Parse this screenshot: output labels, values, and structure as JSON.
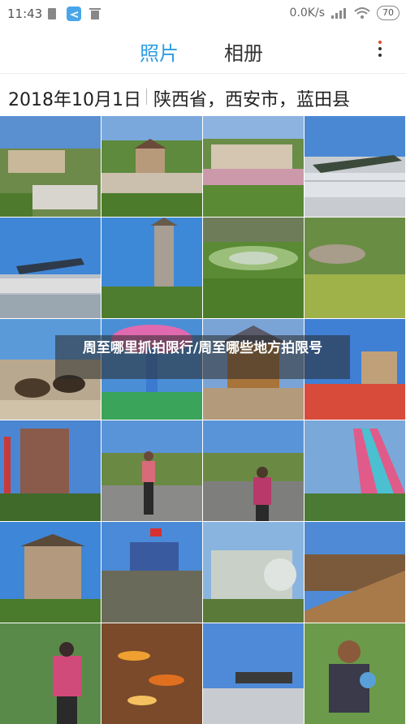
{
  "status_bar": {
    "time": "11:43",
    "network_speed": "0.0K/s",
    "battery": "70",
    "icons": [
      "sim-icon",
      "airplane-icon",
      "trash-icon",
      "signal-icon",
      "wifi-icon",
      "battery-icon"
    ]
  },
  "tabs": [
    {
      "label": "照片",
      "active": true
    },
    {
      "label": "相册",
      "active": false
    }
  ],
  "colors": {
    "accent": "#2e9de0",
    "text": "#222222",
    "notification_dot": "#e04a2a"
  },
  "date_header": {
    "date": "2018年10月1日",
    "location": "陕西省，西安市，蓝田县"
  },
  "overlay": {
    "title": "周至哪里抓拍限行/周至哪些地方拍限号"
  },
  "photos": [
    {
      "name": "photo-village-buildings"
    },
    {
      "name": "photo-chinese-temple"
    },
    {
      "name": "photo-town-overview"
    },
    {
      "name": "photo-airplane-display"
    },
    {
      "name": "photo-fighter-plane"
    },
    {
      "name": "photo-pagoda"
    },
    {
      "name": "photo-stadium-aerial"
    },
    {
      "name": "photo-arena-hills"
    },
    {
      "name": "photo-ostriches"
    },
    {
      "name": "photo-carousel"
    },
    {
      "name": "photo-tent-pavilion"
    },
    {
      "name": "photo-water-tower"
    },
    {
      "name": "photo-playground-slide"
    },
    {
      "name": "photo-man-walking"
    },
    {
      "name": "photo-woman-standing"
    },
    {
      "name": "photo-rainbow-slide"
    },
    {
      "name": "photo-watchtower"
    },
    {
      "name": "photo-stage-flags"
    },
    {
      "name": "photo-train-statue"
    },
    {
      "name": "photo-wooden-stairs"
    },
    {
      "name": "photo-woman-garden"
    },
    {
      "name": "photo-koi-fish"
    },
    {
      "name": "photo-bridge-sign"
    },
    {
      "name": "photo-child-portrait"
    }
  ]
}
